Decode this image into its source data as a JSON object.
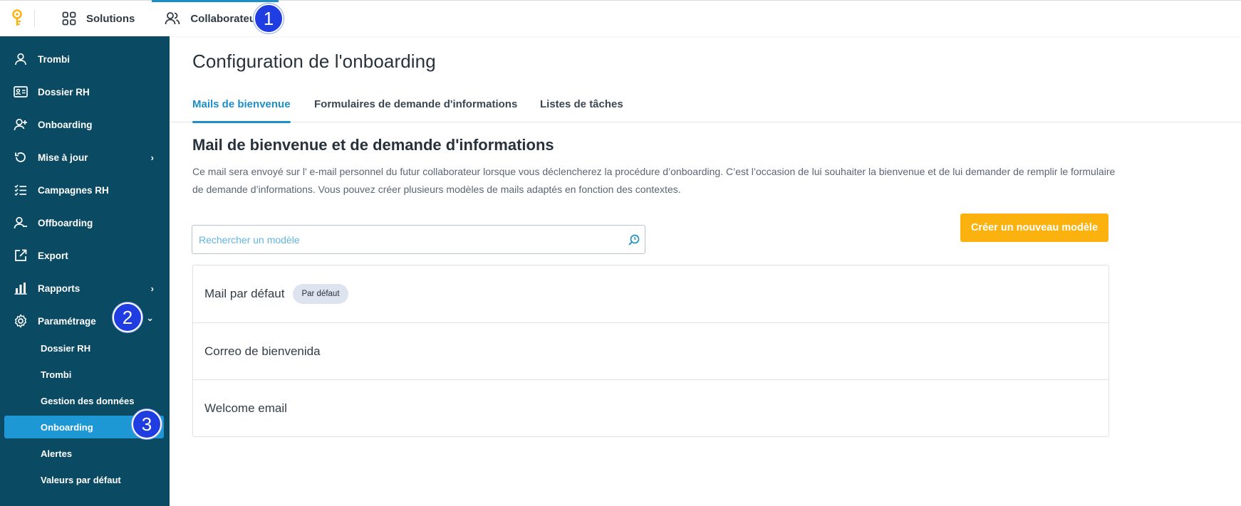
{
  "topbar": {
    "nav": [
      {
        "label": "Solutions",
        "icon": "grid-icon"
      },
      {
        "label": "Collaborateurs",
        "icon": "users-icon"
      }
    ],
    "accent": "#1d8fc8",
    "logo_color": "#fbb20f"
  },
  "markers": [
    "1",
    "2",
    "3"
  ],
  "sidebar": {
    "background": "#0a4a63",
    "items": [
      {
        "label": "Trombi",
        "icon": "user-icon"
      },
      {
        "label": "Dossier RH",
        "icon": "id-card-icon"
      },
      {
        "label": "Onboarding",
        "icon": "user-plus-icon"
      },
      {
        "label": "Mise à jour",
        "icon": "refresh-icon",
        "chevron": "›"
      },
      {
        "label": "Campagnes RH",
        "icon": "checklist-icon"
      },
      {
        "label": "Offboarding",
        "icon": "user-minus-icon"
      },
      {
        "label": "Export",
        "icon": "external-link-icon"
      },
      {
        "label": "Rapports",
        "icon": "bar-chart-icon",
        "chevron": "›"
      },
      {
        "label": "Paramétrage",
        "icon": "gear-icon",
        "chevron": "⌄"
      }
    ],
    "subitems": [
      {
        "label": "Dossier RH"
      },
      {
        "label": "Trombi"
      },
      {
        "label": "Gestion des données"
      },
      {
        "label": "Onboarding",
        "active": true
      },
      {
        "label": "Alertes"
      },
      {
        "label": "Valeurs par défaut"
      }
    ]
  },
  "main": {
    "title": "Configuration de l'onboarding",
    "tabs": [
      {
        "label": "Mails de bienvenue",
        "active": true
      },
      {
        "label": "Formulaires de demande d'informations"
      },
      {
        "label": "Listes de tâches"
      }
    ],
    "section_title": "Mail de bienvenue et de demande d'informations",
    "section_desc": "Ce mail sera envoyé sur l' e-mail personnel du futur collaborateur lorsque vous déclencherez la procédure d’onboarding. C’est l’occasion de lui souhaiter la bienvenue et de lui demander de remplir le formulaire de demande d’informations. Vous pouvez créer plusieurs modèles de mails adaptés en fonction des contextes.",
    "search": {
      "placeholder": "Rechercher un modèle",
      "value": ""
    },
    "create_button": "Créer un nouveau modèle",
    "templates": [
      {
        "name": "Mail par défaut",
        "badge": "Par défaut"
      },
      {
        "name": "Correo de bienvenida"
      },
      {
        "name": "Welcome email"
      }
    ]
  }
}
